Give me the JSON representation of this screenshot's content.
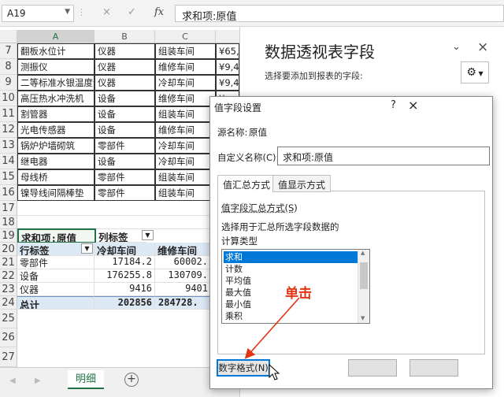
{
  "formula_bar": {
    "name_box": "A19",
    "cancel_icon": "×",
    "enter_icon": "✓",
    "fx_label": "fx",
    "formula": "求和项:原值"
  },
  "sheet": {
    "columns": [
      "A",
      "B",
      "C"
    ],
    "rows": [
      {
        "num": "7",
        "a": "翻板水位计",
        "b": "仪器",
        "c": "组装车间",
        "d": "¥65,("
      },
      {
        "num": "8",
        "a": "测振仪",
        "b": "仪器",
        "c": "维修车间",
        "d": "¥9,4"
      },
      {
        "num": "9",
        "a": "二等标准水银温度计",
        "b": "仪器",
        "c": "冷却车间",
        "d": "¥9,4"
      },
      {
        "num": "10",
        "a": "高压热水冲洗机",
        "b": "设备",
        "c": "维修车间",
        "d": "¥"
      },
      {
        "num": "11",
        "a": "割管器",
        "b": "设备",
        "c": "组装车间",
        "d": "¥"
      },
      {
        "num": "12",
        "a": "光电传感器",
        "b": "设备",
        "c": "维修车间",
        "d": "¥"
      },
      {
        "num": "13",
        "a": "锅炉炉墙砌筑",
        "b": "零部件",
        "c": "冷却车间",
        "d": "¥"
      },
      {
        "num": "14",
        "a": "继电器",
        "b": "设备",
        "c": "冷却车间",
        "d": "¥"
      },
      {
        "num": "15",
        "a": "母线桥",
        "b": "零部件",
        "c": "组装车间",
        "d": "¥"
      },
      {
        "num": "16",
        "a": "镍导线间隔棒垫",
        "b": "零部件",
        "c": "组装车间",
        "d": "¥"
      }
    ],
    "empty_row": "17",
    "empty_row2": "18",
    "pivot": {
      "r19": {
        "num": "19",
        "a": "求和项:原值",
        "b": "列标签"
      },
      "r20": {
        "num": "20",
        "a": "行标签",
        "b": "冷却车间",
        "c": "维修车间"
      },
      "r21": {
        "num": "21",
        "a": "零部件",
        "b": "17184.2",
        "c": "60002."
      },
      "r22": {
        "num": "22",
        "a": "设备",
        "b": "176255.8",
        "c": "130709."
      },
      "r23": {
        "num": "23",
        "a": "仪器",
        "b": "9416",
        "c": "9401"
      },
      "r24": {
        "num": "24",
        "a": "总计",
        "b": "202856",
        "c": "284728."
      }
    },
    "tail_rows": [
      "25",
      "26",
      "27"
    ],
    "sheet_tab": "明细",
    "add_sheet_icon": "+"
  },
  "pane": {
    "title": "数据透视表字段",
    "subtitle": "选择要添加到报表的字段:",
    "close_icon": "×",
    "dropdown_icon": "⌄",
    "gear_icon": "⚙"
  },
  "dialog": {
    "title": "值字段设置",
    "source_label": "源名称:",
    "source_value": "原值",
    "custom_label": "自定义名称(C):",
    "custom_value": "求和项:原值",
    "tabs": [
      "值汇总方式",
      "值显示方式"
    ],
    "group_label": "值字段汇总方式(S)",
    "desc": "选择用于汇总所选字段数据的",
    "calc_type": "计算类型",
    "list_items": [
      "求和",
      "计数",
      "平均值",
      "最大值",
      "最小值",
      "乘积"
    ],
    "selected_index": 0,
    "number_format_button": "数字格式(N)",
    "help_icon": "?",
    "close_icon": "×"
  },
  "annotation": {
    "text": "单击",
    "color": "#e53212"
  }
}
